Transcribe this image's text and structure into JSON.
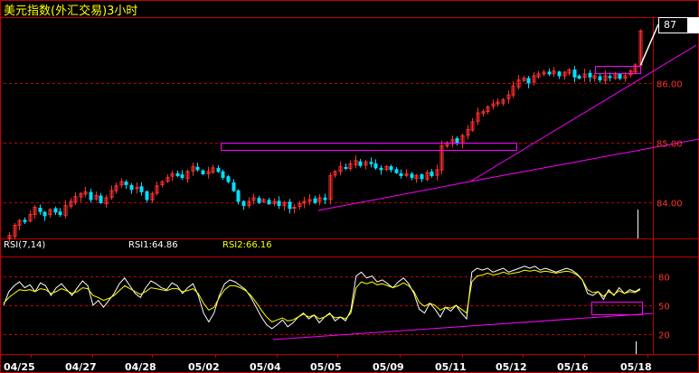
{
  "window": {
    "title": "美元指数(外汇交易)3小时",
    "last_price_tag": "87"
  },
  "rsi_panel": {
    "label": "RSI(7,14)",
    "rsi1": "RSI1:64.86",
    "rsi2": "RSI2:66.16"
  },
  "colors": {
    "background": "#000000",
    "frame": "#c00000",
    "grid": "#c00000",
    "up_candle": "#ff3030",
    "down_candle": "#00e0ff",
    "trendline": "#ff00ff",
    "rsi1_line": "#ffffff",
    "rsi2_line": "#ffff00",
    "axis_text": "#ff3030",
    "date_text": "#ffffff",
    "title_text": "#ffff00"
  },
  "chart_data": [
    {
      "type": "candlestick",
      "title": "美元指数(外汇交易)3小时",
      "y_ticks": [
        "84.00",
        "85.00",
        "86.00"
      ],
      "ylim": [
        83.4,
        87.1
      ],
      "x_ticks": [
        "04/25",
        "04/27",
        "04/28",
        "05/02",
        "05/04",
        "05/05",
        "05/09",
        "05/11",
        "05/12",
        "05/16",
        "05/18"
      ],
      "close_series": [
        83.45,
        83.62,
        83.7,
        83.68,
        83.8,
        83.92,
        83.85,
        83.78,
        83.88,
        83.84,
        83.8,
        83.95,
        84.02,
        84.1,
        84.15,
        84.18,
        84.05,
        84.12,
        84.0,
        84.08,
        84.2,
        84.28,
        84.35,
        84.3,
        84.22,
        84.25,
        84.18,
        84.05,
        84.15,
        84.28,
        84.35,
        84.42,
        84.48,
        84.45,
        84.42,
        84.52,
        84.6,
        84.55,
        84.48,
        84.52,
        84.58,
        84.52,
        84.42,
        84.35,
        84.2,
        84.02,
        83.95,
        84.02,
        84.08,
        84.0,
        84.05,
        83.98,
        84.02,
        83.95,
        84.0,
        83.9,
        83.92,
        83.98,
        84.02,
        84.05,
        84.0,
        84.08,
        84.05,
        84.45,
        84.52,
        84.6,
        84.58,
        84.65,
        84.7,
        84.62,
        84.68,
        84.65,
        84.58,
        84.55,
        84.6,
        84.55,
        84.5,
        84.45,
        84.48,
        84.42,
        84.45,
        84.4,
        84.5,
        84.45,
        84.55,
        84.95,
        85.0,
        85.05,
        85.0,
        85.12,
        85.22,
        85.35,
        85.5,
        85.52,
        85.6,
        85.65,
        85.68,
        85.72,
        85.8,
        85.95,
        86.05,
        86.08,
        86.0,
        86.12,
        86.15,
        86.18,
        86.15,
        86.2,
        86.12,
        86.18,
        86.22,
        86.1,
        86.08,
        86.15,
        86.1,
        86.12,
        86.05,
        86.12,
        86.1,
        86.15,
        86.08,
        86.12,
        86.2,
        86.3,
        86.87
      ]
    },
    {
      "type": "line",
      "title": "RSI(7,14)",
      "y_ticks": [
        "20",
        "50",
        "80"
      ],
      "ylim": [
        0,
        100
      ],
      "series": [
        {
          "name": "RSI1",
          "values": [
            50,
            64,
            70,
            74,
            68,
            71,
            64,
            73,
            70,
            60,
            68,
            72,
            66,
            60,
            68,
            75,
            70,
            50,
            55,
            48,
            55,
            62,
            72,
            78,
            70,
            62,
            58,
            68,
            75,
            72,
            68,
            66,
            73,
            70,
            62,
            68,
            72,
            60,
            42,
            33,
            42,
            60,
            72,
            76,
            74,
            70,
            66,
            58,
            48,
            38,
            30,
            26,
            30,
            35,
            28,
            32,
            38,
            42,
            36,
            40,
            32,
            38,
            42,
            34,
            38,
            34,
            45,
            80,
            84,
            78,
            80,
            74,
            76,
            72,
            68,
            74,
            78,
            72,
            62,
            46,
            42,
            52,
            46,
            38,
            48,
            44,
            50,
            42,
            36,
            84,
            88,
            86,
            88,
            84,
            86,
            88,
            84,
            86,
            88,
            90,
            88,
            90,
            86,
            88,
            86,
            84,
            86,
            88,
            86,
            82,
            76,
            62,
            60,
            64,
            56,
            66,
            60,
            68,
            62,
            66,
            64,
            67
          ]
        },
        {
          "name": "RSI2",
          "values": [
            52,
            58,
            62,
            66,
            65,
            66,
            64,
            67,
            66,
            62,
            64,
            67,
            65,
            62,
            64,
            68,
            67,
            60,
            58,
            55,
            57,
            60,
            65,
            70,
            67,
            64,
            61,
            64,
            68,
            67,
            66,
            65,
            67,
            67,
            64,
            65,
            67,
            62,
            52,
            45,
            48,
            58,
            66,
            70,
            70,
            68,
            65,
            60,
            53,
            45,
            38,
            33,
            35,
            37,
            34,
            35,
            38,
            41,
            38,
            40,
            36,
            38,
            41,
            37,
            38,
            36,
            42,
            68,
            74,
            72,
            74,
            71,
            72,
            70,
            68,
            70,
            73,
            70,
            64,
            53,
            49,
            52,
            50,
            45,
            48,
            47,
            50,
            46,
            42,
            74,
            80,
            81,
            83,
            81,
            82,
            84,
            82,
            83,
            84,
            86,
            85,
            86,
            84,
            85,
            84,
            83,
            84,
            85,
            84,
            81,
            76,
            66,
            63,
            64,
            59,
            64,
            61,
            65,
            62,
            64,
            63,
            66
          ]
        }
      ]
    }
  ]
}
